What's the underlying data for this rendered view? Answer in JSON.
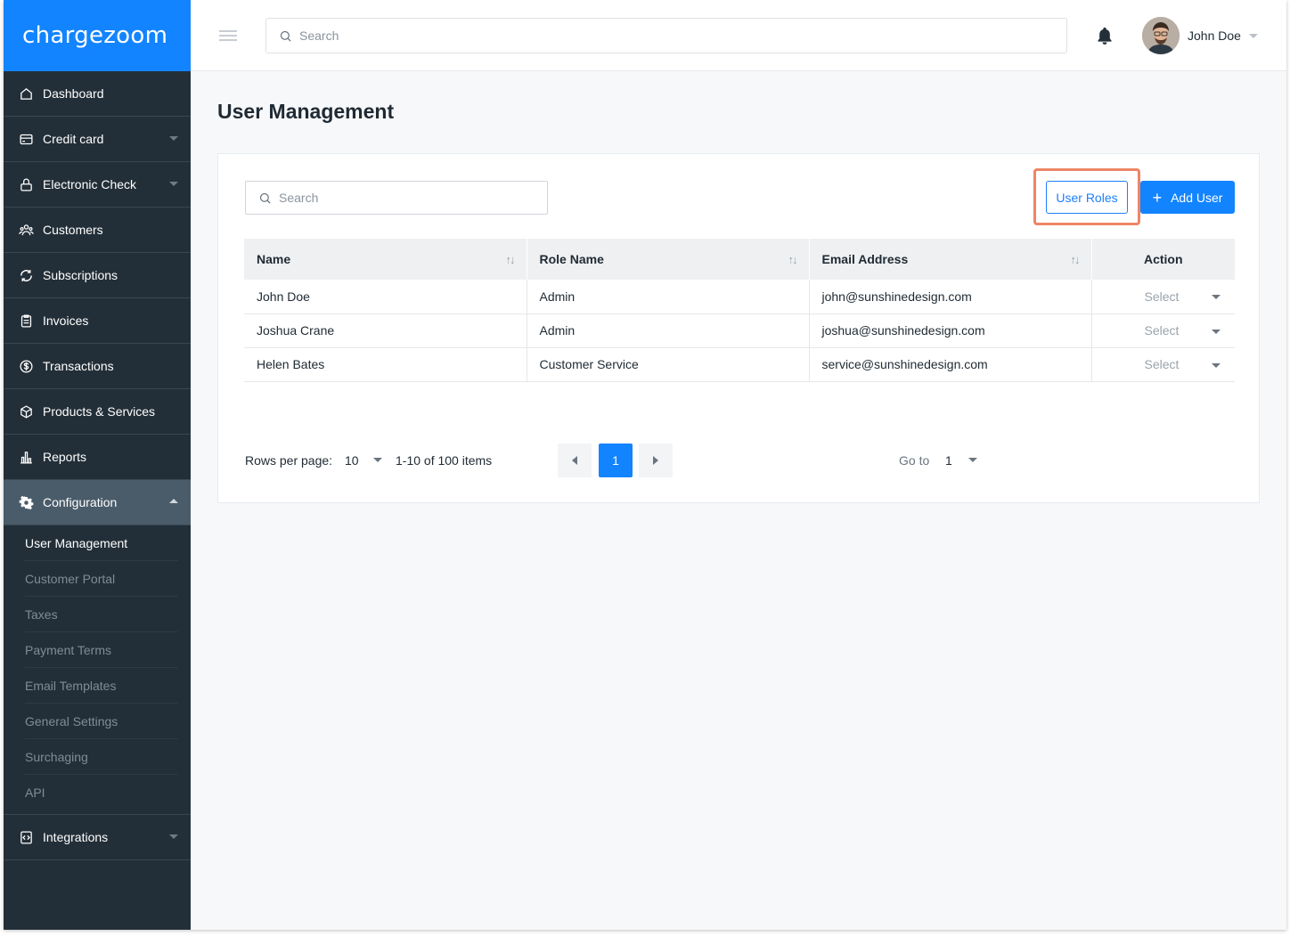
{
  "brand": {
    "logo_text": "chargezoom",
    "accent": "#1384ff"
  },
  "header": {
    "search_placeholder": "Search",
    "user_name": "John Doe"
  },
  "sidebar": {
    "items": [
      {
        "label": "Dashboard",
        "icon": "home-icon"
      },
      {
        "label": "Credit card",
        "icon": "credit-card-icon"
      },
      {
        "label": "Electronic Check",
        "icon": "lock-icon"
      },
      {
        "label": "Customers",
        "icon": "customers-icon"
      },
      {
        "label": "Subscriptions",
        "icon": "refresh-icon"
      },
      {
        "label": "Invoices",
        "icon": "invoice-icon"
      },
      {
        "label": "Transactions",
        "icon": "dollar-icon"
      },
      {
        "label": "Products & Services",
        "icon": "box-icon"
      },
      {
        "label": "Reports",
        "icon": "bar-chart-icon"
      },
      {
        "label": "Configuration",
        "icon": "gear-icon"
      }
    ],
    "config_sub": [
      "User Management",
      "Customer Portal",
      "Taxes",
      "Payment Terms",
      "Email Templates",
      "General Settings",
      "Surchaging",
      "API"
    ],
    "integrations": {
      "label": "Integrations",
      "icon": "code-icon"
    }
  },
  "main": {
    "title": "User Management",
    "search_placeholder": "Search",
    "user_roles_label": "User Roles",
    "add_user_label": "Add User",
    "columns": [
      "Name",
      "Role Name",
      "Email Address",
      "Action"
    ],
    "rows": [
      {
        "name": "John Doe",
        "role": "Admin",
        "email": "john@sunshinedesign.com",
        "action": "Select"
      },
      {
        "name": "Joshua Crane",
        "role": "Admin",
        "email": "joshua@sunshinedesign.com",
        "action": "Select"
      },
      {
        "name": "Helen Bates",
        "role": "Customer Service",
        "email": "service@sunshinedesign.com",
        "action": "Select"
      }
    ],
    "pagination": {
      "rows_per_page_label": "Rows per page:",
      "rows_per_page": "10",
      "items_text": "1-10 of 100 items",
      "current_page": "1",
      "goto_label": "Go to",
      "goto_value": "1"
    }
  }
}
